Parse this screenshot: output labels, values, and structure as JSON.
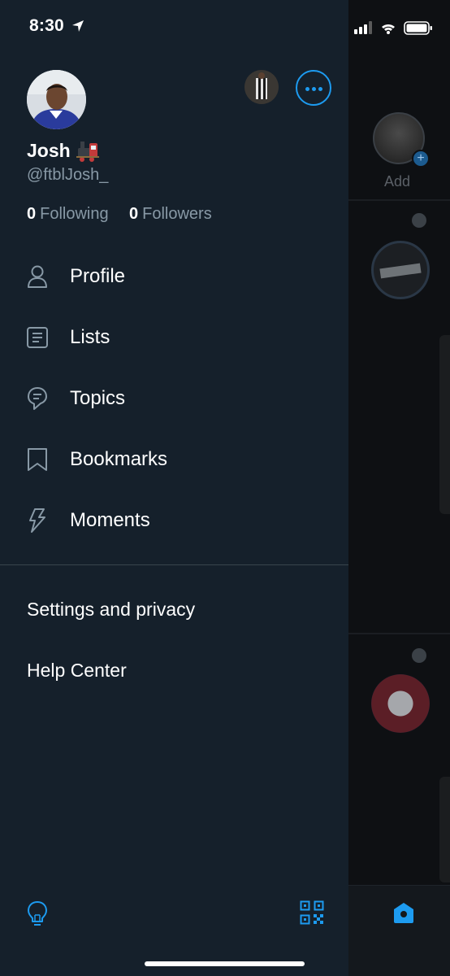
{
  "status_bar": {
    "time": "8:30"
  },
  "profile": {
    "name": "Josh",
    "handle": "@ftblJosh_",
    "following_count": "0",
    "following_label": "Following",
    "followers_count": "0",
    "followers_label": "Followers"
  },
  "menu": [
    {
      "label": "Profile",
      "icon": "person-icon"
    },
    {
      "label": "Lists",
      "icon": "list-icon"
    },
    {
      "label": "Topics",
      "icon": "topics-icon"
    },
    {
      "label": "Bookmarks",
      "icon": "bookmark-icon"
    },
    {
      "label": "Moments",
      "icon": "lightning-icon"
    }
  ],
  "links": {
    "settings": "Settings and privacy",
    "help": "Help Center"
  },
  "background": {
    "fleet_add_label": "Add"
  },
  "colors": {
    "drawer_bg": "#15202b",
    "accent": "#1d9bf0",
    "secondary_text": "#8899a6"
  }
}
